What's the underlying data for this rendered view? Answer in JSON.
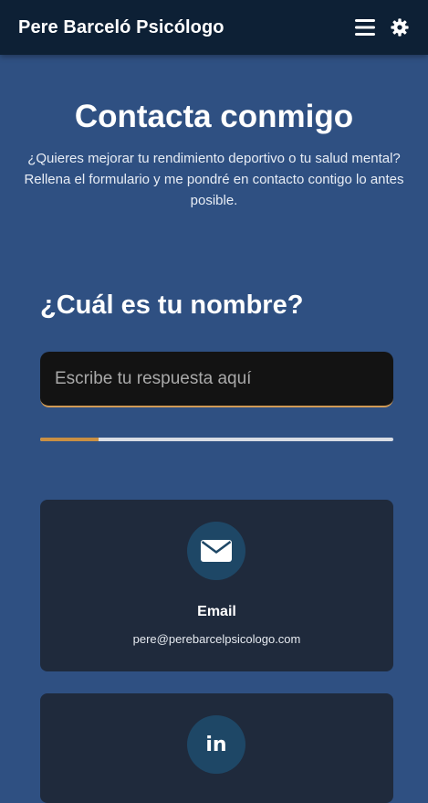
{
  "header": {
    "brand": "Pere Barceló Psicólogo",
    "menu_icon": "hamburger-menu-icon",
    "settings_icon": "gear-icon"
  },
  "hero": {
    "title": "Contacta conmigo",
    "description": "¿Quieres mejorar tu rendimiento deportivo o tu salud mental? Rellena el formulario y me pondré en contacto contigo lo antes posible."
  },
  "form": {
    "question": "¿Cuál es tu nombre?",
    "answer_placeholder": "Escribe tu respuesta aquí",
    "answer_value": "",
    "progress_fraction": 0.165
  },
  "contact_cards": [
    {
      "icon": "envelope-icon",
      "title": "Email",
      "detail": "pere@perebarcelpsicologo.com"
    },
    {
      "icon": "linkedin-icon",
      "icon_text": "in"
    }
  ],
  "colors": {
    "header_bg": "#0d2035",
    "page_bg": "#2f5082",
    "accent": "#c98f43",
    "card_bg": "#1f2a3c",
    "icon_circle": "#1e4766"
  }
}
